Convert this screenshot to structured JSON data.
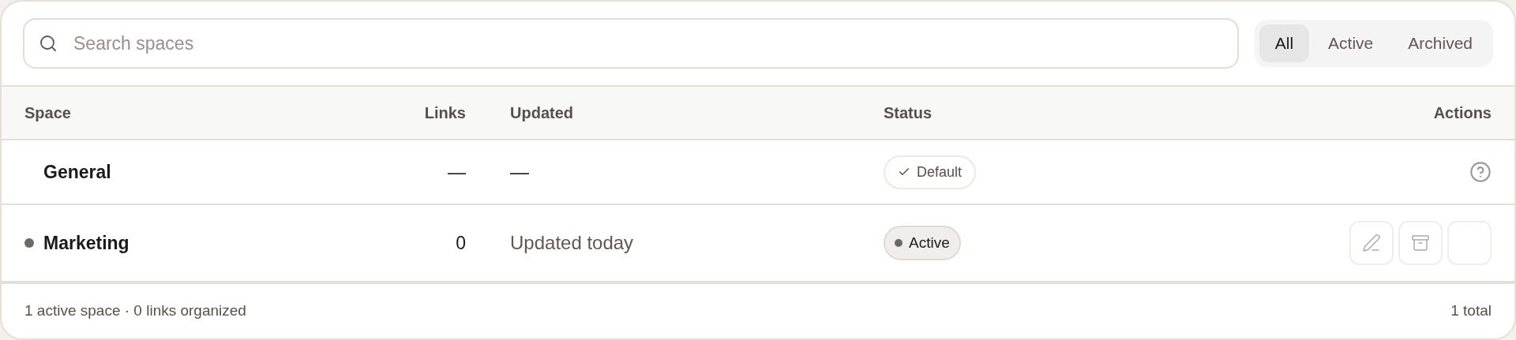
{
  "search": {
    "placeholder": "Search spaces"
  },
  "filters": [
    {
      "label": "All",
      "selected": true
    },
    {
      "label": "Active",
      "selected": false
    },
    {
      "label": "Archived",
      "selected": false
    }
  ],
  "table": {
    "columns": [
      "Space",
      "Links",
      "Updated",
      "Status",
      "Actions"
    ],
    "rows": [
      {
        "name": "General",
        "dot": false,
        "links": "—",
        "updated": {
          "kind": "dash",
          "text": "—"
        },
        "status": {
          "kind": "default",
          "label": "Default"
        },
        "actions": {
          "kind": "help"
        }
      },
      {
        "name": "Marketing",
        "dot": true,
        "links": "0",
        "updated": {
          "kind": "text",
          "text": "Updated today"
        },
        "status": {
          "kind": "active",
          "label": "Active"
        },
        "actions": {
          "kind": "buttons"
        }
      }
    ]
  },
  "footer": {
    "summary": "1 active space · 0 links organized",
    "total": "1 total"
  }
}
